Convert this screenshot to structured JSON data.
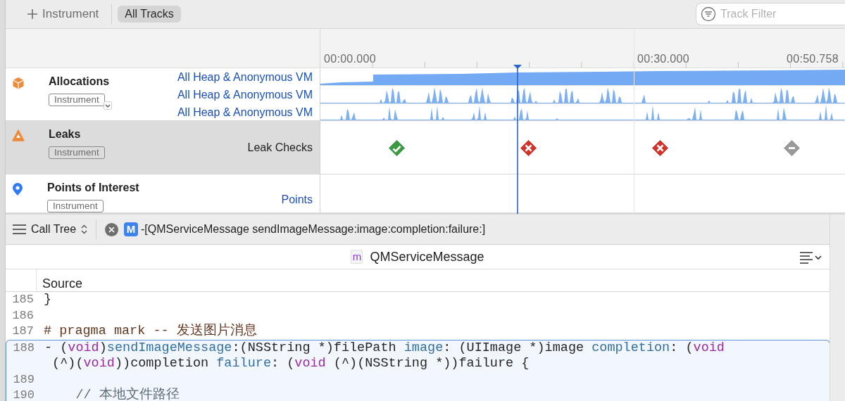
{
  "toolbar": {
    "add_button": "Instrument",
    "filter_tab": {
      "label": "All Tracks",
      "selected": true
    },
    "track_filter": {
      "placeholder": "Track Filter"
    }
  },
  "ruler": {
    "labels": [
      "00:00.000",
      "00:30.000",
      "00:50.758"
    ]
  },
  "tracks": [
    {
      "kind": "allocations",
      "name": "Allocations",
      "badge": "Instrument",
      "has_menu": true,
      "selected": false,
      "lanes": [
        {
          "label": "All Heap & Anonymous VM",
          "link": true
        },
        {
          "label": "All Heap & Anonymous VM",
          "link": true
        },
        {
          "label": "All Heap & Anonymous VM",
          "link": true
        }
      ]
    },
    {
      "kind": "leaks",
      "name": "Leaks",
      "badge": "Instrument",
      "has_menu": false,
      "selected": true,
      "lanes": [
        {
          "label": "Leak Checks",
          "link": false
        }
      ],
      "checks": [
        {
          "kind": "pass"
        },
        {
          "kind": "leak"
        },
        {
          "kind": "leak"
        },
        {
          "kind": "none"
        }
      ]
    },
    {
      "kind": "points",
      "name": "Points of Interest",
      "badge": "Instrument",
      "has_menu": false,
      "selected": false,
      "lanes": [
        {
          "label": "Points",
          "link": true
        }
      ]
    }
  ],
  "detail_bar": {
    "view_menu": "Call Tree",
    "symbol_badge": "M",
    "symbol": "-[QMServiceMessage sendImageMessage:image:completion:failure:]"
  },
  "source": {
    "file_badge": "m",
    "file_name": "QMServiceMessage",
    "column": "Source",
    "lines": [
      {
        "number": "185",
        "selected": false,
        "segments": [
          {
            "text": "}",
            "kind": "plain"
          }
        ]
      },
      {
        "number": "186",
        "selected": false
      },
      {
        "number": "187",
        "selected": false,
        "segments": [
          {
            "text": "# pragma mark -- 发送图片消息",
            "kind": "directive"
          }
        ]
      },
      {
        "number": "188",
        "selected": true,
        "segments": [
          {
            "text": "- (",
            "kind": "plain"
          },
          {
            "text": "void",
            "kind": "keyword"
          },
          {
            "text": ")",
            "kind": "plain"
          },
          {
            "text": "sendImageMessage",
            "kind": "method"
          },
          {
            "text": ":(NSString *)filePath ",
            "kind": "plain"
          },
          {
            "text": "image",
            "kind": "method"
          },
          {
            "text": ": (UIImage *)image ",
            "kind": "plain"
          },
          {
            "text": "completion",
            "kind": "method"
          },
          {
            "text": ": (",
            "kind": "plain"
          },
          {
            "text": "void",
            "kind": "keyword"
          }
        ],
        "wrap_segments": [
          {
            "text": " (^)(",
            "kind": "plain"
          },
          {
            "text": "void",
            "kind": "keyword"
          },
          {
            "text": "))completion ",
            "kind": "plain"
          },
          {
            "text": "failure",
            "kind": "method"
          },
          {
            "text": ": (",
            "kind": "plain"
          },
          {
            "text": "void",
            "kind": "keyword"
          },
          {
            "text": " (^)(NSString *))failure {",
            "kind": "plain"
          }
        ]
      },
      {
        "number": "189",
        "selected": true
      },
      {
        "number": "190",
        "selected": true,
        "segments": [
          {
            "text": "    // 本地文件路径",
            "kind": "comment"
          }
        ]
      }
    ]
  }
}
